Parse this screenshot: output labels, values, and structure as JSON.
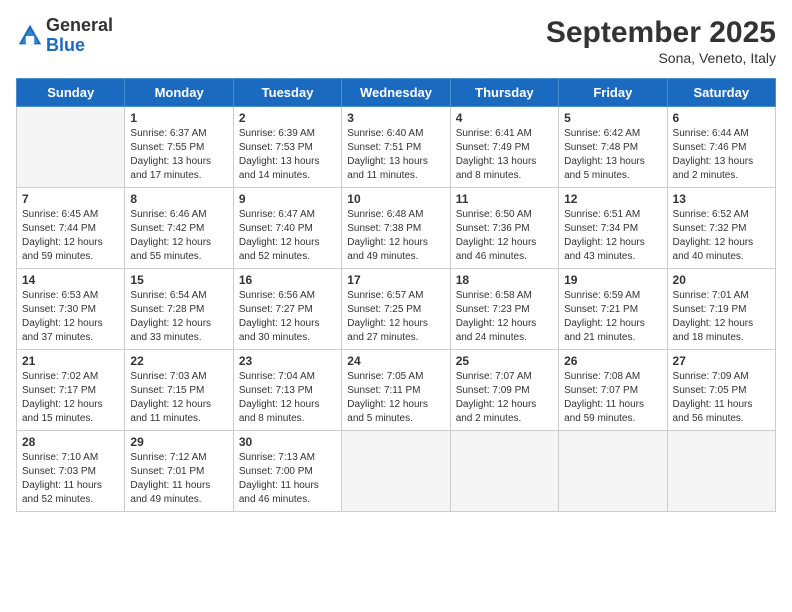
{
  "header": {
    "logo_general": "General",
    "logo_blue": "Blue",
    "title": "September 2025",
    "location": "Sona, Veneto, Italy"
  },
  "days_of_week": [
    "Sunday",
    "Monday",
    "Tuesday",
    "Wednesday",
    "Thursday",
    "Friday",
    "Saturday"
  ],
  "weeks": [
    [
      {
        "day": "",
        "sunrise": "",
        "sunset": "",
        "daylight": ""
      },
      {
        "day": "1",
        "sunrise": "Sunrise: 6:37 AM",
        "sunset": "Sunset: 7:55 PM",
        "daylight": "Daylight: 13 hours and 17 minutes."
      },
      {
        "day": "2",
        "sunrise": "Sunrise: 6:39 AM",
        "sunset": "Sunset: 7:53 PM",
        "daylight": "Daylight: 13 hours and 14 minutes."
      },
      {
        "day": "3",
        "sunrise": "Sunrise: 6:40 AM",
        "sunset": "Sunset: 7:51 PM",
        "daylight": "Daylight: 13 hours and 11 minutes."
      },
      {
        "day": "4",
        "sunrise": "Sunrise: 6:41 AM",
        "sunset": "Sunset: 7:49 PM",
        "daylight": "Daylight: 13 hours and 8 minutes."
      },
      {
        "day": "5",
        "sunrise": "Sunrise: 6:42 AM",
        "sunset": "Sunset: 7:48 PM",
        "daylight": "Daylight: 13 hours and 5 minutes."
      },
      {
        "day": "6",
        "sunrise": "Sunrise: 6:44 AM",
        "sunset": "Sunset: 7:46 PM",
        "daylight": "Daylight: 13 hours and 2 minutes."
      }
    ],
    [
      {
        "day": "7",
        "sunrise": "Sunrise: 6:45 AM",
        "sunset": "Sunset: 7:44 PM",
        "daylight": "Daylight: 12 hours and 59 minutes."
      },
      {
        "day": "8",
        "sunrise": "Sunrise: 6:46 AM",
        "sunset": "Sunset: 7:42 PM",
        "daylight": "Daylight: 12 hours and 55 minutes."
      },
      {
        "day": "9",
        "sunrise": "Sunrise: 6:47 AM",
        "sunset": "Sunset: 7:40 PM",
        "daylight": "Daylight: 12 hours and 52 minutes."
      },
      {
        "day": "10",
        "sunrise": "Sunrise: 6:48 AM",
        "sunset": "Sunset: 7:38 PM",
        "daylight": "Daylight: 12 hours and 49 minutes."
      },
      {
        "day": "11",
        "sunrise": "Sunrise: 6:50 AM",
        "sunset": "Sunset: 7:36 PM",
        "daylight": "Daylight: 12 hours and 46 minutes."
      },
      {
        "day": "12",
        "sunrise": "Sunrise: 6:51 AM",
        "sunset": "Sunset: 7:34 PM",
        "daylight": "Daylight: 12 hours and 43 minutes."
      },
      {
        "day": "13",
        "sunrise": "Sunrise: 6:52 AM",
        "sunset": "Sunset: 7:32 PM",
        "daylight": "Daylight: 12 hours and 40 minutes."
      }
    ],
    [
      {
        "day": "14",
        "sunrise": "Sunrise: 6:53 AM",
        "sunset": "Sunset: 7:30 PM",
        "daylight": "Daylight: 12 hours and 37 minutes."
      },
      {
        "day": "15",
        "sunrise": "Sunrise: 6:54 AM",
        "sunset": "Sunset: 7:28 PM",
        "daylight": "Daylight: 12 hours and 33 minutes."
      },
      {
        "day": "16",
        "sunrise": "Sunrise: 6:56 AM",
        "sunset": "Sunset: 7:27 PM",
        "daylight": "Daylight: 12 hours and 30 minutes."
      },
      {
        "day": "17",
        "sunrise": "Sunrise: 6:57 AM",
        "sunset": "Sunset: 7:25 PM",
        "daylight": "Daylight: 12 hours and 27 minutes."
      },
      {
        "day": "18",
        "sunrise": "Sunrise: 6:58 AM",
        "sunset": "Sunset: 7:23 PM",
        "daylight": "Daylight: 12 hours and 24 minutes."
      },
      {
        "day": "19",
        "sunrise": "Sunrise: 6:59 AM",
        "sunset": "Sunset: 7:21 PM",
        "daylight": "Daylight: 12 hours and 21 minutes."
      },
      {
        "day": "20",
        "sunrise": "Sunrise: 7:01 AM",
        "sunset": "Sunset: 7:19 PM",
        "daylight": "Daylight: 12 hours and 18 minutes."
      }
    ],
    [
      {
        "day": "21",
        "sunrise": "Sunrise: 7:02 AM",
        "sunset": "Sunset: 7:17 PM",
        "daylight": "Daylight: 12 hours and 15 minutes."
      },
      {
        "day": "22",
        "sunrise": "Sunrise: 7:03 AM",
        "sunset": "Sunset: 7:15 PM",
        "daylight": "Daylight: 12 hours and 11 minutes."
      },
      {
        "day": "23",
        "sunrise": "Sunrise: 7:04 AM",
        "sunset": "Sunset: 7:13 PM",
        "daylight": "Daylight: 12 hours and 8 minutes."
      },
      {
        "day": "24",
        "sunrise": "Sunrise: 7:05 AM",
        "sunset": "Sunset: 7:11 PM",
        "daylight": "Daylight: 12 hours and 5 minutes."
      },
      {
        "day": "25",
        "sunrise": "Sunrise: 7:07 AM",
        "sunset": "Sunset: 7:09 PM",
        "daylight": "Daylight: 12 hours and 2 minutes."
      },
      {
        "day": "26",
        "sunrise": "Sunrise: 7:08 AM",
        "sunset": "Sunset: 7:07 PM",
        "daylight": "Daylight: 11 hours and 59 minutes."
      },
      {
        "day": "27",
        "sunrise": "Sunrise: 7:09 AM",
        "sunset": "Sunset: 7:05 PM",
        "daylight": "Daylight: 11 hours and 56 minutes."
      }
    ],
    [
      {
        "day": "28",
        "sunrise": "Sunrise: 7:10 AM",
        "sunset": "Sunset: 7:03 PM",
        "daylight": "Daylight: 11 hours and 52 minutes."
      },
      {
        "day": "29",
        "sunrise": "Sunrise: 7:12 AM",
        "sunset": "Sunset: 7:01 PM",
        "daylight": "Daylight: 11 hours and 49 minutes."
      },
      {
        "day": "30",
        "sunrise": "Sunrise: 7:13 AM",
        "sunset": "Sunset: 7:00 PM",
        "daylight": "Daylight: 11 hours and 46 minutes."
      },
      {
        "day": "",
        "sunrise": "",
        "sunset": "",
        "daylight": ""
      },
      {
        "day": "",
        "sunrise": "",
        "sunset": "",
        "daylight": ""
      },
      {
        "day": "",
        "sunrise": "",
        "sunset": "",
        "daylight": ""
      },
      {
        "day": "",
        "sunrise": "",
        "sunset": "",
        "daylight": ""
      }
    ]
  ]
}
